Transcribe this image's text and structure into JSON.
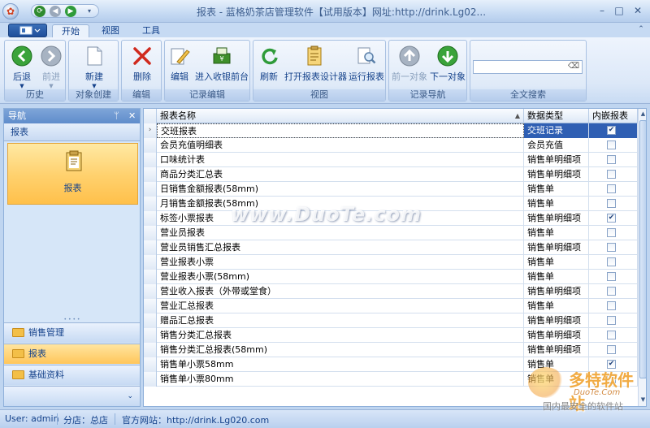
{
  "window": {
    "title": "报表 - 蓝格奶茶店管理软件【试用版本】网址:http://drink.Lg02..."
  },
  "tabs": [
    {
      "label": "开始"
    },
    {
      "label": "视图"
    },
    {
      "label": "工具"
    }
  ],
  "ribbon": {
    "groups": {
      "history": {
        "label": "历史",
        "back": "后退",
        "forward": "前进"
      },
      "create": {
        "label": "对象创建",
        "new": "新建"
      },
      "edit": {
        "label": "编辑",
        "delete": "删除"
      },
      "record_edit": {
        "label": "记录编辑",
        "edit": "编辑",
        "enter_pos": "进入收银前台"
      },
      "view": {
        "label": "视图",
        "refresh": "刷新",
        "open_designer": "打开报表设计器",
        "run_report": "运行报表"
      },
      "record_nav": {
        "label": "记录导航",
        "prev": "前一对象",
        "next": "下一对象"
      },
      "fulltext": {
        "label": "全文搜索"
      }
    }
  },
  "nav": {
    "title": "导航",
    "section": "报表",
    "selected_item": "报表",
    "buttons": [
      {
        "label": "销售管理"
      },
      {
        "label": "报表"
      },
      {
        "label": "基础资料"
      }
    ]
  },
  "grid": {
    "columns": [
      "报表名称",
      "数据类型",
      "内嵌报表"
    ],
    "rows": [
      {
        "name": "交班报表",
        "type": "交班记录",
        "embedded": true
      },
      {
        "name": "会员充值明细表",
        "type": "会员充值",
        "embedded": false
      },
      {
        "name": "口味统计表",
        "type": "销售单明细项",
        "embedded": false
      },
      {
        "name": "商品分类汇总表",
        "type": "销售单明细项",
        "embedded": false
      },
      {
        "name": "日销售金额报表(58mm)",
        "type": "销售单",
        "embedded": false
      },
      {
        "name": "月销售金额报表(58mm)",
        "type": "销售单",
        "embedded": false
      },
      {
        "name": "标签小票报表",
        "type": "销售单明细项",
        "embedded": true
      },
      {
        "name": "营业员报表",
        "type": "销售单",
        "embedded": false
      },
      {
        "name": "营业员销售汇总报表",
        "type": "销售单明细项",
        "embedded": false
      },
      {
        "name": "营业报表小票",
        "type": "销售单",
        "embedded": false
      },
      {
        "name": "营业报表小票(58mm)",
        "type": "销售单",
        "embedded": false
      },
      {
        "name": "营业收入报表（外带或堂食）",
        "type": "销售单明细项",
        "embedded": false
      },
      {
        "name": "营业汇总报表",
        "type": "销售单",
        "embedded": false
      },
      {
        "name": "赠品汇总报表",
        "type": "销售单明细项",
        "embedded": false
      },
      {
        "name": "销售分类汇总报表",
        "type": "销售单明细项",
        "embedded": false
      },
      {
        "name": "销售分类汇总报表(58mm)",
        "type": "销售单明细项",
        "embedded": false
      },
      {
        "name": "销售单小票58mm",
        "type": "销售单",
        "embedded": true
      },
      {
        "name": "销售单小票80mm",
        "type": "销售单",
        "embedded": false
      }
    ]
  },
  "status": {
    "user": "User: admin",
    "store": "分店：总店",
    "website": "官方网站：http://drink.Lg020.com"
  },
  "watermarks": {
    "center": "www.DuoTe.com",
    "corner_big": "多特软件站",
    "corner_sub": "DuoTe.Com",
    "corner_slogan": "国内最安全的软件站"
  },
  "colors": {
    "accent": "#15428b",
    "selection": "#2f5fb3",
    "nav_selected": "#ffd270"
  }
}
